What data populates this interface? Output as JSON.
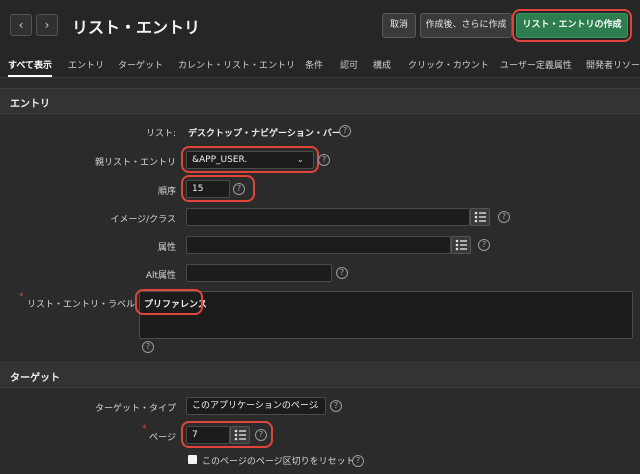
{
  "header": {
    "title": "リスト・エントリ",
    "cancel_label": "取消",
    "create_another_label": "作成後、さらに作成",
    "create_label": "リスト・エントリの作成"
  },
  "tabs": [
    "すべて表示",
    "エントリ",
    "ターゲット",
    "カレント・リスト・エントリ",
    "条件",
    "認可",
    "構成",
    "クリック・カウント",
    "ユーザー定義属性",
    "開発者リソース"
  ],
  "entry_section": {
    "title": "エントリ",
    "list_label": "リスト:",
    "list_value": "デスクトップ・ナビゲーション・バー",
    "parent_label": "親リスト・エントリ",
    "parent_value": "&APP_USER.",
    "sequence_label": "順序",
    "sequence_value": "15",
    "image_label": "イメージ/クラス",
    "image_value": "",
    "attributes_label": "属性",
    "attributes_value": "",
    "alt_label": "Alt属性",
    "alt_value": "",
    "entry_label_label": "リスト・エントリ・ラベル",
    "entry_label_value": "プリファレンス"
  },
  "target_section": {
    "title": "ターゲット",
    "target_type_label": "ターゲット・タイプ",
    "target_type_value": "このアプリケーションのページ",
    "page_label": "ページ",
    "page_value": "7",
    "reset_pagination_label": "このページのページ区切りをリセット"
  },
  "colors": {
    "accent": "#2e7d4f",
    "highlight": "#e0453a",
    "required": "#e0453a"
  }
}
